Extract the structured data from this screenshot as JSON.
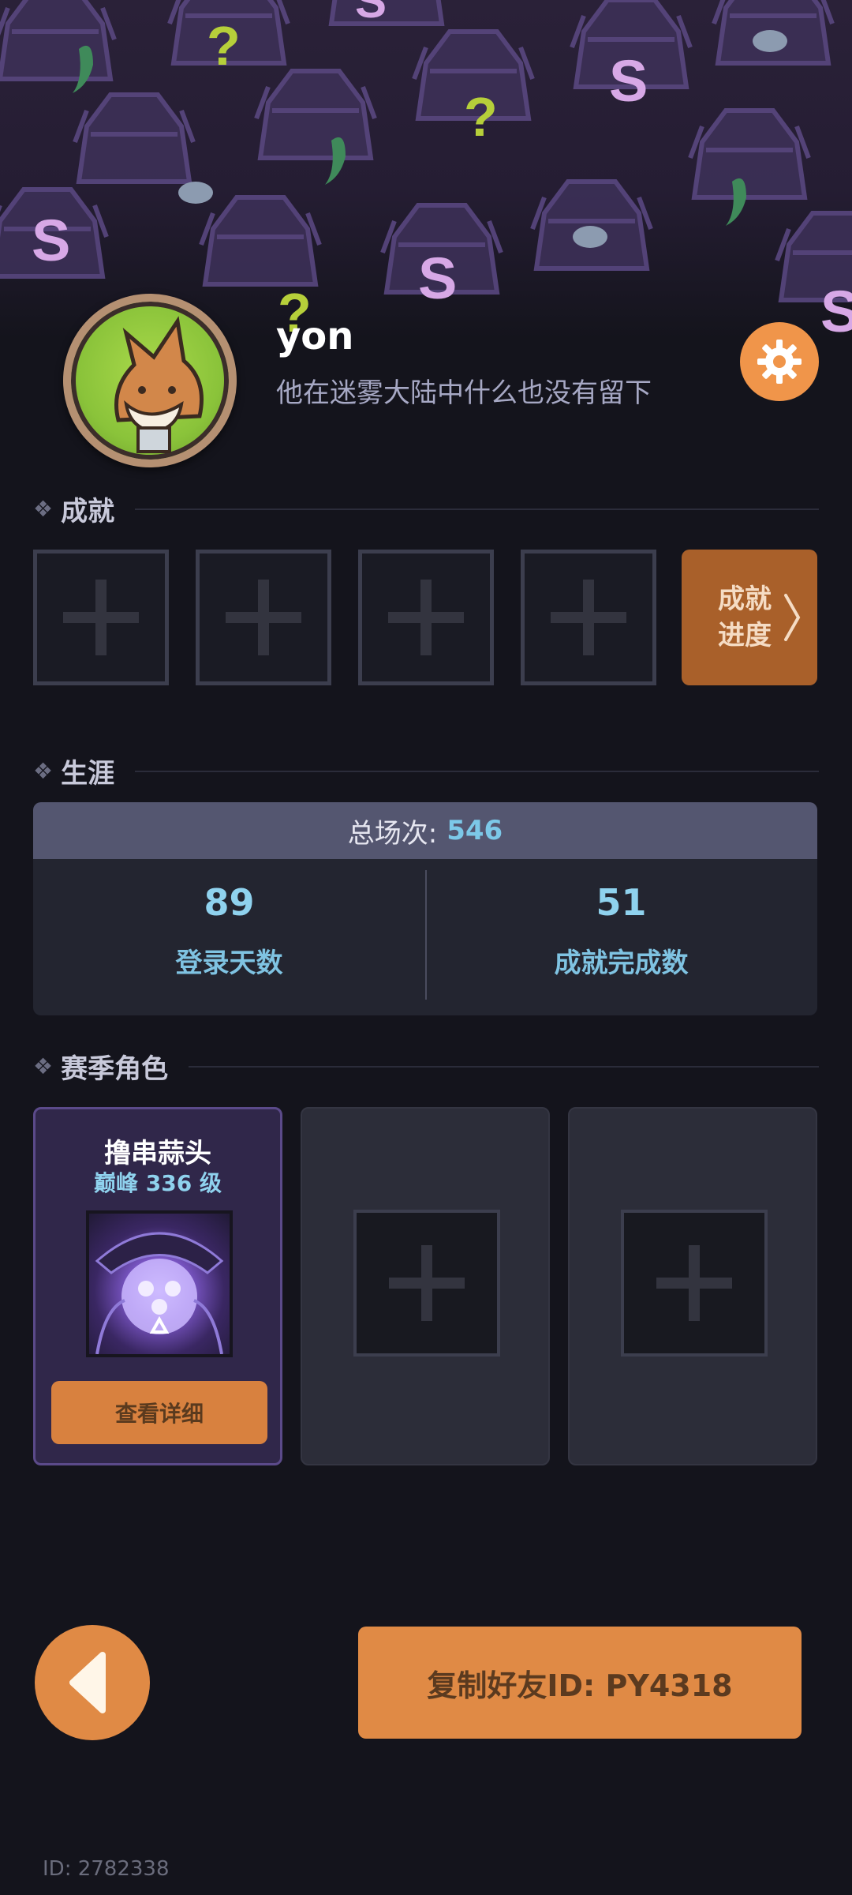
{
  "profile": {
    "username": "yon",
    "bio": "他在迷雾大陆中什么也没有留下"
  },
  "sections": {
    "achievements": "成就",
    "career": "生涯",
    "season_roles": "赛季角色"
  },
  "achievements": {
    "slots": 4,
    "progress_label_line1": "成就",
    "progress_label_line2": "进度"
  },
  "career": {
    "total_label": "总场次:",
    "total_value": "546",
    "stats": [
      {
        "value": "89",
        "label": "登录天数"
      },
      {
        "value": "51",
        "label": "成就完成数"
      }
    ]
  },
  "season_roles": {
    "active": {
      "name": "撸串蒜头",
      "level": "巅峰 336 级",
      "detail_button": "查看详细"
    }
  },
  "footer": {
    "copy_friend_button": "复制好友ID: PY4318",
    "id_text": "ID: 2782338"
  },
  "icons": {
    "settings": "gear-icon",
    "back": "back-arrow-icon",
    "chevron": "chevron-right-icon"
  },
  "colors": {
    "accent_orange": "#e08a45",
    "stat_blue": "#8fd2ee",
    "background": "#14141c"
  }
}
